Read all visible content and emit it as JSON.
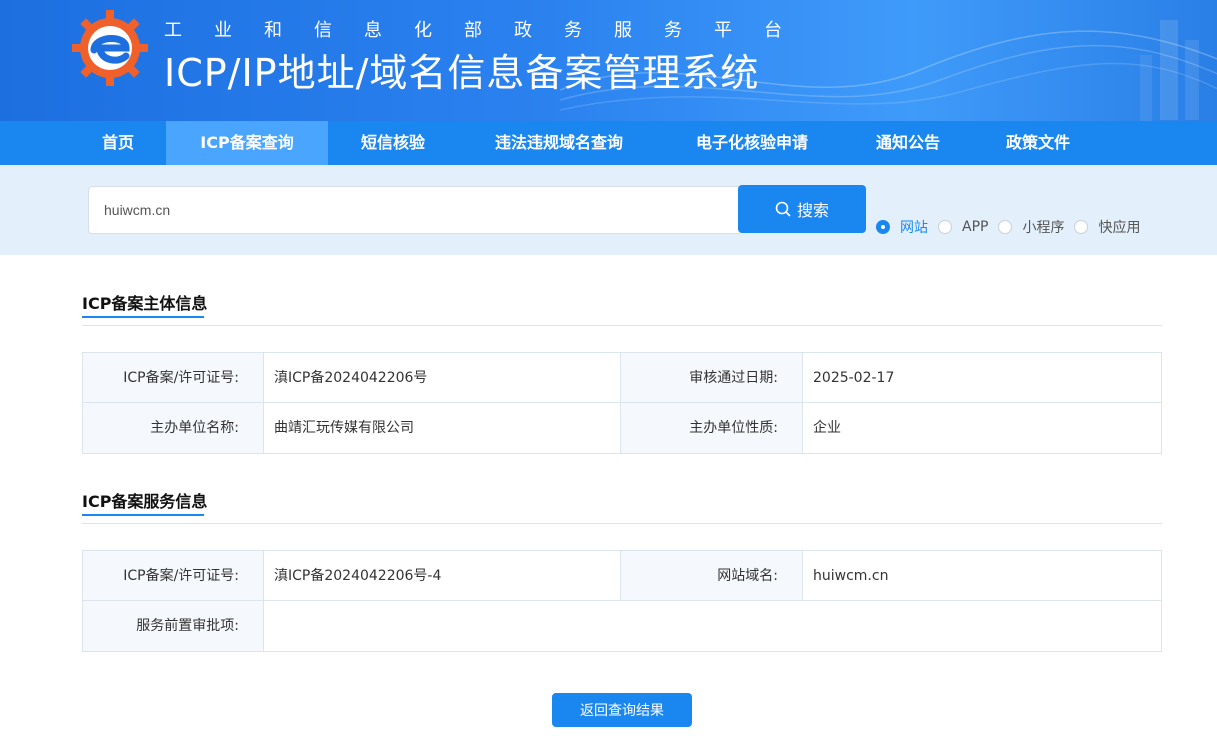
{
  "header": {
    "sub_title_chars": [
      "工",
      "业",
      "和",
      "信",
      "息",
      "化",
      "部",
      "政",
      "务",
      "服",
      "务",
      "平",
      "台"
    ],
    "title": "ICP/IP地址/域名信息备案管理系统",
    "logo_icon": "miit-gear-logo-icon",
    "colors": {
      "brand_blue": "#1a87f0",
      "logo_orange": "#f0602a"
    }
  },
  "nav": {
    "items": [
      {
        "label": "首页",
        "active": false
      },
      {
        "label": "ICP备案查询",
        "active": true
      },
      {
        "label": "短信核验",
        "active": false
      },
      {
        "label": "违法违规域名查询",
        "active": false
      },
      {
        "label": "电子化核验申请",
        "active": false
      },
      {
        "label": "通知公告",
        "active": false
      },
      {
        "label": "政策文件",
        "active": false
      }
    ]
  },
  "search": {
    "value": "huiwcm.cn",
    "button_label": "搜索",
    "button_icon": "search-icon",
    "types": [
      {
        "label": "网站",
        "checked": true
      },
      {
        "label": "APP",
        "checked": false
      },
      {
        "label": "小程序",
        "checked": false
      },
      {
        "label": "快应用",
        "checked": false
      }
    ]
  },
  "subject": {
    "title": "ICP备案主体信息",
    "rows": [
      {
        "label1": "ICP备案/许可证号:",
        "value1": "滇ICP备2024042206号",
        "label2": "审核通过日期:",
        "value2": "2025-02-17"
      },
      {
        "label1": "主办单位名称:",
        "value1": "曲靖汇玩传媒有限公司",
        "label2": "主办单位性质:",
        "value2": "企业"
      }
    ]
  },
  "service": {
    "title": "ICP备案服务信息",
    "row1": {
      "label1": "ICP备案/许可证号:",
      "value1": "滇ICP备2024042206号-4",
      "label2": "网站域名:",
      "value2": "huiwcm.cn"
    },
    "row2": {
      "label": "服务前置审批项:",
      "value": ""
    }
  },
  "back_button_label": "返回查询结果"
}
